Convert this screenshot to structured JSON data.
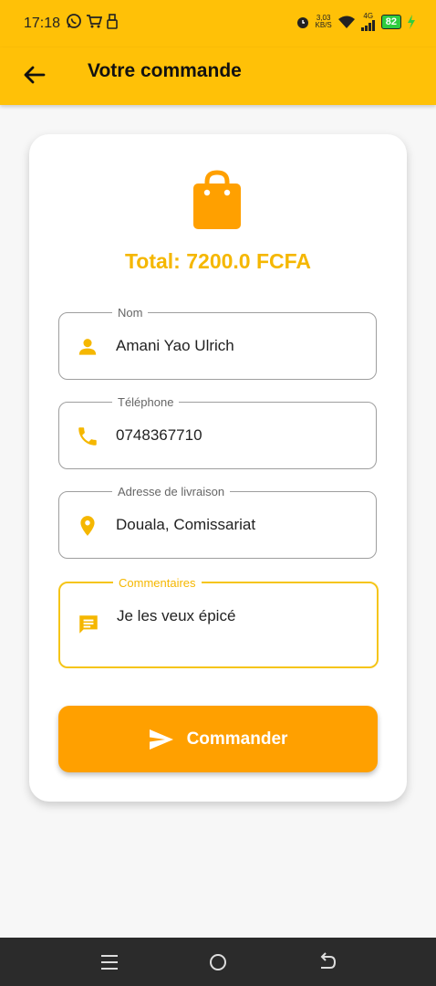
{
  "status_bar": {
    "time": "17:18",
    "speed_value": "3,03",
    "speed_unit": "KB/S",
    "network": "4G",
    "battery": "82",
    "icons": [
      "whatsapp-icon",
      "cart-icon",
      "usb-icon",
      "alarm-icon",
      "wifi-icon",
      "signal-icon",
      "battery-icon",
      "charging-icon"
    ]
  },
  "app_bar": {
    "title": "Votre commande",
    "back_icon": "arrow-left-icon"
  },
  "order": {
    "bag_icon": "shopping-bag-icon",
    "total": "Total: 7200.0 FCFA"
  },
  "form": {
    "name": {
      "label": "Nom",
      "value": "Amani Yao Ulrich",
      "icon": "person-icon"
    },
    "phone": {
      "label": "Téléphone",
      "value": "0748367710",
      "icon": "phone-icon"
    },
    "address": {
      "label": "Adresse de livraison",
      "value": "Douala, Comissariat",
      "icon": "location-pin-icon"
    },
    "comments": {
      "label": "Commentaires",
      "value": "Je les veux épicé",
      "icon": "comment-icon"
    }
  },
  "submit": {
    "label": "Commander",
    "icon": "send-icon"
  },
  "colors": {
    "primary": "#FFC107",
    "accent_text": "#F5B700",
    "button": "#FFA000",
    "icon": "#F5B700"
  },
  "nav_bar": {
    "icons": [
      "menu-icon",
      "home-circle-icon",
      "back-icon"
    ]
  }
}
